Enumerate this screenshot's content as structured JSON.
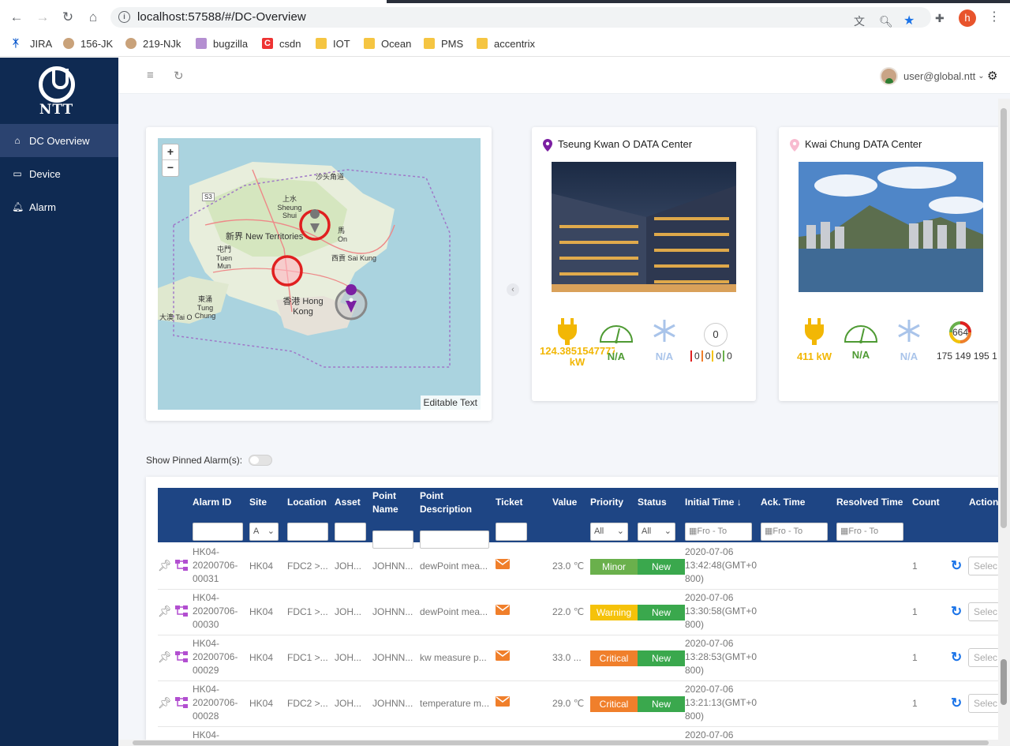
{
  "browser": {
    "url": "localhost:57588/#/DC-Overview",
    "bookmarks": [
      "JIRA",
      "156-JK",
      "219-NJk",
      "bugzilla",
      "csdn",
      "IOT",
      "Ocean",
      "PMS",
      "accentrix"
    ],
    "profile_initial": "h"
  },
  "sidebar": {
    "logo_text": "NTT",
    "items": [
      {
        "label": "DC Overview",
        "icon": "home-icon",
        "active": true
      },
      {
        "label": "Device",
        "icon": "monitor-icon",
        "active": false
      },
      {
        "label": "Alarm",
        "icon": "bell-icon",
        "active": false
      }
    ]
  },
  "topbar": {
    "user": "user@global.ntt"
  },
  "map": {
    "zoom_in": "+",
    "zoom_out": "−",
    "attribution": "Editable Text",
    "labels": {
      "sha_tau_kok": "沙头角道",
      "sheung_shui": "上水 Sheung\nShui",
      "new_territories": "新界 New Territories",
      "tuen_mun": "屯門 Tuen\nMun",
      "ma_on_shan": "馬\nOn",
      "sai_kung": "西貢 Sai Kung",
      "tung_chung": "東涌 Tung\nChung",
      "tai_o": "大澳 Tai O",
      "hong_kong": "香港 Hong\nKong",
      "s3": "S3"
    }
  },
  "dc_cards": [
    {
      "title": "Tseung Kwan O DATA Center",
      "power": "124.385154777777 11",
      "power_unit": "kW",
      "pue": "N/A",
      "cooling": "N/A",
      "alarm_total": "0",
      "alarm_breakdown": [
        "0",
        "0",
        "0",
        "0"
      ],
      "pin_color": "#7b1fa2"
    },
    {
      "title": "Kwai Chung DATA Center",
      "power": "411 kW",
      "pue": "N/A",
      "cooling": "N/A",
      "alarm_total": "664",
      "alarm_breakdown_text": "175 149 195 1",
      "pin_color": "#f8bbd0"
    }
  ],
  "alarms": {
    "pinned_label": "Show Pinned Alarm(s):",
    "columns": {
      "alarm_id": "Alarm ID",
      "site": "Site",
      "location": "Location",
      "asset": "Asset",
      "point_name": "Point\nName",
      "point_description": "Point\nDescription",
      "ticket": "Ticket",
      "value": "Value",
      "priority": "Priority",
      "status": "Status",
      "initial_time": "Initial Time",
      "ack_time": "Ack. Time",
      "resolved_time": "Resolved Time",
      "count": "Count",
      "action": "Action"
    },
    "filters": {
      "site": "A",
      "priority": "All",
      "status": "All",
      "from": "Fro",
      "to": "To"
    },
    "rows": [
      {
        "id": "HK04-\n20200706-\n00031",
        "site": "HK04",
        "location": "FDC2 >...",
        "asset": "JOH...",
        "point_name": "JOHNN...",
        "desc": "dewPoint mea...",
        "value": "23.0 ℃",
        "priority": "Minor",
        "priority_color": "#6ab04c",
        "status": "New",
        "initial_time": "2020-07-06\n13:42:48(GMT+0\n800)",
        "count": "1",
        "action": "Selec"
      },
      {
        "id": "HK04-\n20200706-\n00030",
        "site": "HK04",
        "location": "FDC1 >...",
        "asset": "JOH...",
        "point_name": "JOHNN...",
        "desc": "dewPoint mea...",
        "value": "22.0 ℃",
        "priority": "Warning",
        "priority_color": "#f5c20a",
        "status": "New",
        "initial_time": "2020-07-06\n13:30:58(GMT+0\n800)",
        "count": "1",
        "action": "Selec"
      },
      {
        "id": "HK04-\n20200706-\n00029",
        "site": "HK04",
        "location": "FDC1 >...",
        "asset": "JOH...",
        "point_name": "JOHNN...",
        "desc": "kw measure p...",
        "value": "33.0 ...",
        "priority": "Critical",
        "priority_color": "#f07f2b",
        "status": "New",
        "initial_time": "2020-07-06\n13:28:53(GMT+0\n800)",
        "count": "1",
        "action": "Selec"
      },
      {
        "id": "HK04-\n20200706-\n00028",
        "site": "HK04",
        "location": "FDC2 >...",
        "asset": "JOH...",
        "point_name": "JOHNN...",
        "desc": "temperature m...",
        "value": "29.0 ℃",
        "priority": "Critical",
        "priority_color": "#f07f2b",
        "status": "New",
        "initial_time": "2020-07-06\n13:21:13(GMT+0\n800)",
        "count": "1",
        "action": "Selec"
      },
      {
        "id": "HK04-",
        "site": "",
        "location": "",
        "asset": "",
        "point_name": "",
        "desc": "",
        "value": "",
        "priority": "",
        "priority_color": "",
        "status": "",
        "initial_time": "2020-07-06",
        "count": "",
        "action": ""
      }
    ]
  },
  "colors": {
    "sidebar": "#0f2a52",
    "table_header": "#1e4584",
    "status_new": "#3aa84d",
    "power": "#f2b705",
    "pue": "#4e9a33",
    "cooling": "#a9c4ea"
  }
}
